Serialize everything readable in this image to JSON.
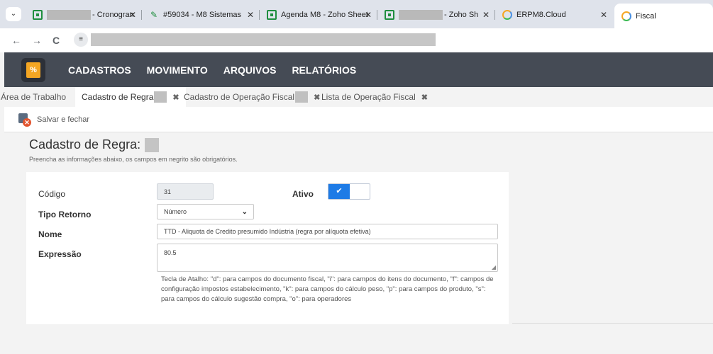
{
  "browser": {
    "menu_glyph": "⌄",
    "tabs": [
      {
        "title": "- Cronogran",
        "icon": "sheet-icon",
        "has_mask": true
      },
      {
        "title": "#59034 - M8 Sistemas",
        "icon": "leaf-icon",
        "has_mask": false
      },
      {
        "title": "Agenda M8 - Zoho Sheet",
        "icon": "sheet-icon",
        "has_mask": false
      },
      {
        "title": "- Zoho Sh",
        "icon": "sheet-icon",
        "has_mask": true
      },
      {
        "title": "ERPM8.Cloud",
        "icon": "ring-icon",
        "has_mask": false
      },
      {
        "title": "Fiscal",
        "icon": "ring-icon",
        "has_mask": false
      }
    ],
    "close_glyph": "✕",
    "back_glyph": "←",
    "forward_glyph": "→",
    "reload_glyph": "C",
    "site_info_glyph": "≡"
  },
  "app": {
    "logo_text": "%",
    "menu": [
      "CADASTROS",
      "MOVIMENTO",
      "ARQUIVOS",
      "RELATÓRIOS"
    ]
  },
  "doc_tabs": [
    {
      "label": "Área de Trabalho"
    },
    {
      "label": "Cadastro de Regra"
    },
    {
      "label": "Cadastro de Operação Fiscal"
    },
    {
      "label": "Lista de Operação Fiscal"
    }
  ],
  "doc_tab_close": "✖",
  "toolbar": {
    "save_close_label": "Salvar e fechar",
    "save_close_icon": "save-close-icon"
  },
  "page": {
    "title": "Cadastro de Regra:",
    "subtitle": "Preencha as informações abaixo, os campos em negrito são obrigatórios."
  },
  "form": {
    "codigo_label": "Código",
    "codigo_value": "31",
    "ativo_label": "Ativo",
    "ativo_checked": true,
    "ativo_check_glyph": "✔",
    "tipo_retorno_label": "Tipo Retorno",
    "tipo_retorno_value": "Número",
    "select_chevron": "⌄",
    "nome_label": "Nome",
    "nome_value": "TTD - Aliquota de Credito presumido Indústria (regra por alíquota efetiva)",
    "expressao_label": "Expressão",
    "expressao_value": "80.5",
    "help_text": "Tecla de Atalho: \"d\": para campos do documento fiscal, \"i\": para campos do itens do documento, \"f\": campos de configuração impostos estabelecimento, \"k\": para campos do cálculo peso, \"p\": para campos do produto, \"s\": para campos do cálculo sugestão compra, \"o\": para operadores"
  },
  "colors": {
    "header_bg": "#454b55",
    "accent": "#1e7be6",
    "logo": "#f4a623",
    "error_icon": "#e2552f"
  }
}
